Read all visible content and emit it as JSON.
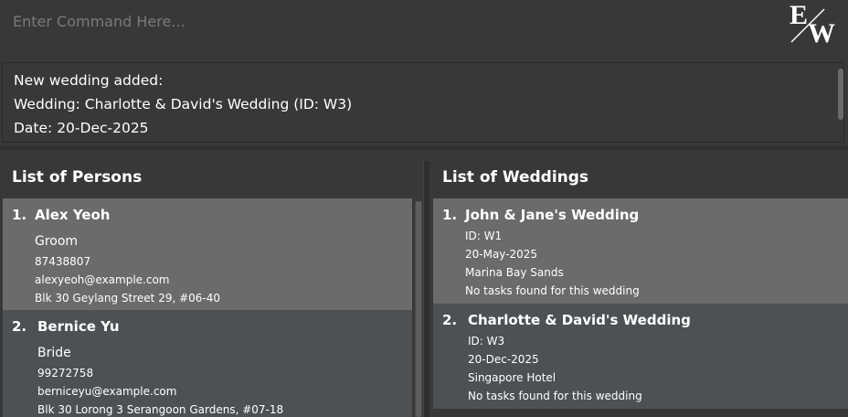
{
  "command": {
    "placeholder": "Enter Command Here...",
    "value": ""
  },
  "logo": {
    "letter_top": "E",
    "letter_bottom": "W"
  },
  "result": {
    "lines": [
      "New wedding added:",
      "Wedding: Charlotte & David's Wedding (ID: W3)",
      "Date: 20-Dec-2025"
    ]
  },
  "persons": {
    "title": "List of Persons",
    "items": [
      {
        "index": "1.",
        "name": "Alex Yeoh",
        "role": "Groom",
        "phone": "87438807",
        "email": "alexyeoh@example.com",
        "address": "Blk 30 Geylang Street 29, #06-40"
      },
      {
        "index": "2.",
        "name": "Bernice Yu",
        "role": "Bride",
        "phone": "99272758",
        "email": "berniceyu@example.com",
        "address": "Blk 30 Lorong 3 Serangoon Gardens, #07-18"
      }
    ]
  },
  "weddings": {
    "title": "List of Weddings",
    "items": [
      {
        "index": "1.",
        "name": "John & Jane's Wedding",
        "id": "ID: W1",
        "date": "20-May-2025",
        "venue": "Marina Bay Sands",
        "tasks": "No tasks found for this wedding"
      },
      {
        "index": "2.",
        "name": "Charlotte & David's Wedding",
        "id": "ID: W3",
        "date": "20-Dec-2025",
        "venue": "Singapore Hotel",
        "tasks": "No tasks found for this wedding"
      }
    ]
  },
  "colors": {
    "background": "#383838",
    "card_selected": "#6b6b6b",
    "card_alt": "#4d5153"
  }
}
